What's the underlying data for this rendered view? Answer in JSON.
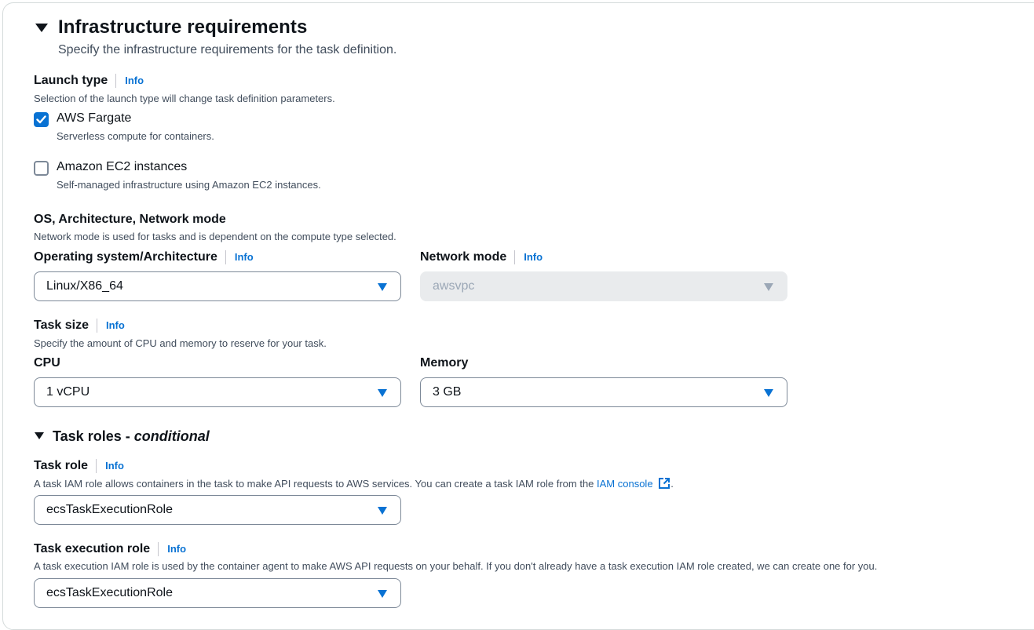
{
  "section": {
    "title": "Infrastructure requirements",
    "description": "Specify the infrastructure requirements for the task definition."
  },
  "launch_type": {
    "label": "Launch type",
    "info": "Info",
    "hint": "Selection of the launch type will change task definition parameters.",
    "options": [
      {
        "label": "AWS Fargate",
        "description": "Serverless compute for containers.",
        "checked": true
      },
      {
        "label": "Amazon EC2 instances",
        "description": "Self-managed infrastructure using Amazon EC2 instances.",
        "checked": false
      }
    ]
  },
  "os_arch": {
    "label": "OS, Architecture, Network mode",
    "hint": "Network mode is used for tasks and is dependent on the compute type selected.",
    "os_label": "Operating system/Architecture",
    "os_info": "Info",
    "os_value": "Linux/X86_64",
    "network_label": "Network mode",
    "network_info": "Info",
    "network_value": "awsvpc"
  },
  "task_size": {
    "label": "Task size",
    "info": "Info",
    "hint": "Specify the amount of CPU and memory to reserve for your task.",
    "cpu_label": "CPU",
    "cpu_value": "1 vCPU",
    "memory_label": "Memory",
    "memory_value": "3 GB"
  },
  "task_roles": {
    "title": "Task roles - ",
    "title_suffix": "conditional",
    "task_role_label": "Task role",
    "task_role_info": "Info",
    "task_role_hint": "A task IAM role allows containers in the task to make API requests to AWS services. You can create a task IAM role from the ",
    "task_role_link": "IAM console",
    "task_role_hint_end": ".",
    "task_role_value": "ecsTaskExecutionRole",
    "exec_role_label": "Task execution role",
    "exec_role_info": "Info",
    "exec_role_hint": "A task execution IAM role is used by the container agent to make AWS API requests on your behalf. If you don't already have a task execution IAM role created, we can create one for you.",
    "exec_role_value": "ecsTaskExecutionRole"
  },
  "colors": {
    "accent": "#0972d3",
    "text": "#0f141a",
    "muted": "#414d5c",
    "disabled_bg": "#e9ebed"
  }
}
